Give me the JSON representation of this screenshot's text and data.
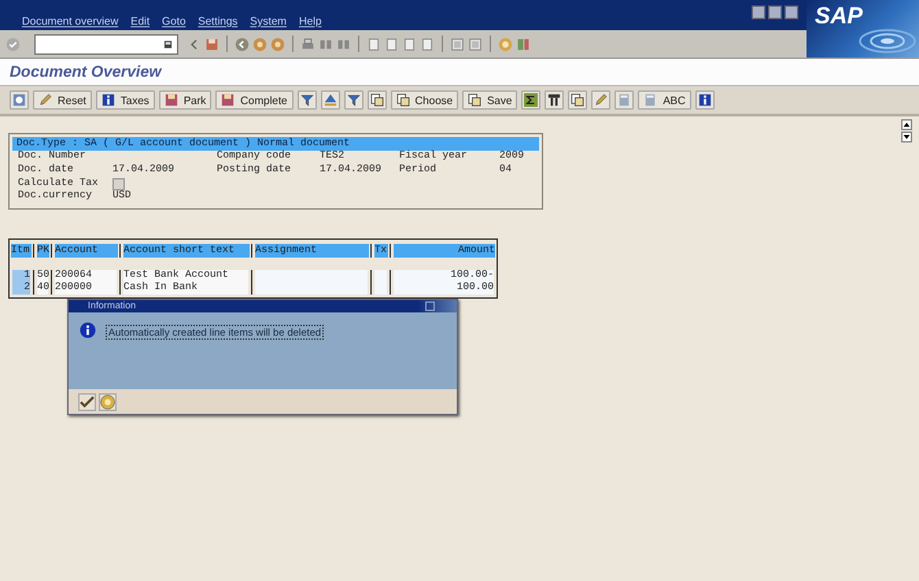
{
  "menu": [
    "Document overview",
    "Edit",
    "Goto",
    "Settings",
    "System",
    "Help"
  ],
  "logo": "SAP",
  "page_title": "Document Overview",
  "app_toolbar": [
    {
      "kind": "icon-button"
    },
    {
      "kind": "button",
      "label": "Reset"
    },
    {
      "kind": "button",
      "label": "Taxes"
    },
    {
      "kind": "button",
      "label": "Park"
    },
    {
      "kind": "button",
      "label": "Complete"
    },
    {
      "kind": "icon-button"
    },
    {
      "kind": "icon-button"
    },
    {
      "kind": "icon-button"
    },
    {
      "kind": "icon-button"
    },
    {
      "kind": "button",
      "label": "Choose"
    },
    {
      "kind": "button",
      "label": "Save"
    },
    {
      "kind": "icon-button"
    },
    {
      "kind": "icon-button"
    },
    {
      "kind": "icon-button"
    },
    {
      "kind": "icon-button"
    },
    {
      "kind": "icon-button"
    },
    {
      "kind": "button",
      "label": "ABC"
    },
    {
      "kind": "icon-button"
    }
  ],
  "header": {
    "title": "Doc.Type : SA ( G/L account document ) Normal document",
    "fields": [
      {
        "label": "Doc. Number"
      },
      {
        "label": "Company code",
        "value": "TES2"
      },
      {
        "label": "Fiscal year",
        "value": "2009"
      },
      {
        "label": "Doc. date",
        "value": "17.04.2009"
      },
      {
        "label": "Posting date",
        "value": "17.04.2009"
      },
      {
        "label": "Period",
        "value": "04"
      }
    ],
    "calculate_tax": {
      "label": "Calculate Tax",
      "checked": false
    },
    "currency": {
      "label": "Doc.currency",
      "value": "USD"
    }
  },
  "table": {
    "columns": [
      "Itm",
      "PK",
      "Account",
      "Account short text",
      "Assignment",
      "Tx",
      "Amount"
    ],
    "rows": [
      [
        "1",
        "50",
        "200064",
        "Test Bank Account",
        "",
        "",
        "100.00-"
      ],
      [
        "2",
        "40",
        "200000",
        "Cash In Bank",
        "",
        "",
        "100.00"
      ]
    ]
  },
  "dialog": {
    "title": "Information",
    "message": "Automatically created line items will be deleted"
  }
}
